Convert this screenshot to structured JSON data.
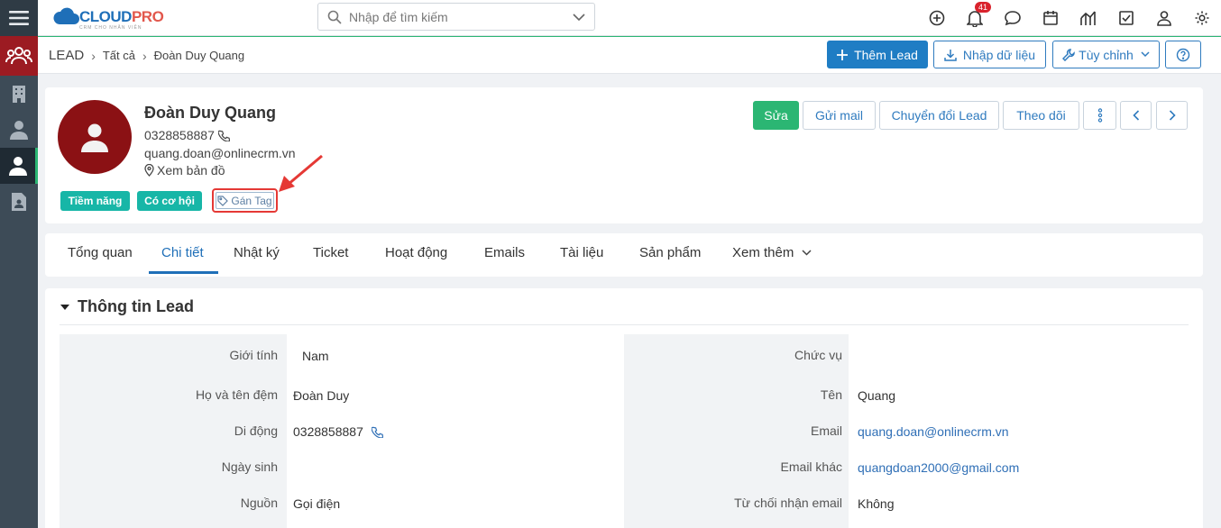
{
  "topbar": {
    "logo_main": "CLOUD",
    "logo_accent": "PRO",
    "logo_sub": "CRM CHO NHÂN VIÊN",
    "search_placeholder": "Nhập để tìm kiếm",
    "notification_count": "41"
  },
  "breadcrumb": {
    "module": "LEAD",
    "filter": "Tất cả",
    "record": "Đoàn Duy Quang"
  },
  "toolbar": {
    "add_lead": "Thêm Lead",
    "import": "Nhập dữ liệu",
    "customize": "Tùy chỉnh"
  },
  "profile": {
    "name": "Đoàn Duy Quang",
    "phone": "0328858887",
    "email": "quang.doan@onlinecrm.vn",
    "map_link": "Xem bản đồ",
    "tags": [
      "Tiềm năng",
      "Có cơ hội"
    ],
    "assign_tag": "Gán Tag",
    "actions": {
      "edit": "Sửa",
      "send_mail": "Gửi mail",
      "convert": "Chuyển đổi Lead",
      "follow": "Theo dõi"
    }
  },
  "tabs": [
    "Tổng quan",
    "Chi tiết",
    "Nhật ký",
    "Ticket",
    "Hoạt động",
    "Emails",
    "Tài liệu",
    "Sản phẩm",
    "Xem thêm"
  ],
  "active_tab": "Chi tiết",
  "section": {
    "title": "Thông tin Lead",
    "left_fields": [
      {
        "label": "Giới tính",
        "value": "Nam"
      },
      {
        "label": "Họ và tên đệm",
        "value": "Đoàn Duy"
      },
      {
        "label": "Di động",
        "value": "0328858887"
      },
      {
        "label": "Ngày sinh",
        "value": ""
      },
      {
        "label": "Nguồn",
        "value": "Gọi điện"
      }
    ],
    "right_fields": [
      {
        "label": "Chức vụ",
        "value": ""
      },
      {
        "label": "Tên",
        "value": "Quang"
      },
      {
        "label": "Email",
        "value": "quang.doan@onlinecrm.vn"
      },
      {
        "label": "Email khác",
        "value": "quangdoan2000@gmail.com"
      },
      {
        "label": "Từ chối nhận email",
        "value": "Không"
      }
    ]
  },
  "colors": {
    "primary": "#1f7dc4",
    "green": "#2bb673",
    "tag_teal": "#17b6a7",
    "avatar_red": "#8b1114",
    "highlight_red": "#e53935"
  }
}
